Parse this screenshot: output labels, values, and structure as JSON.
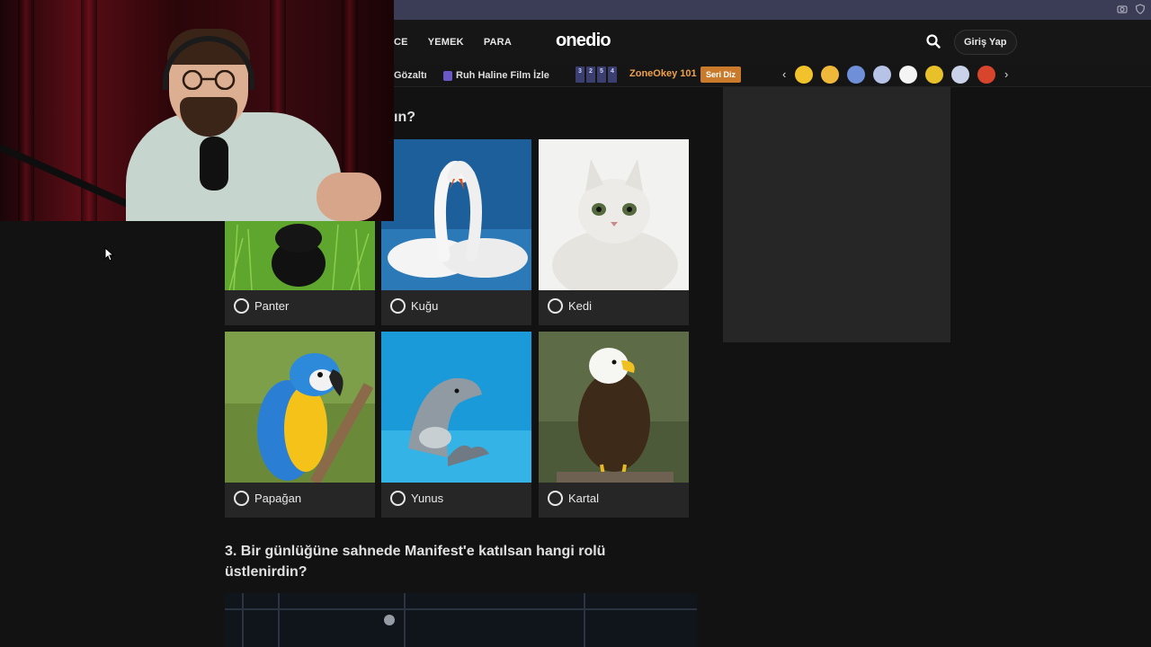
{
  "header": {
    "nav": [
      "CE",
      "YEMEK",
      "PARA"
    ],
    "logo": "onedio",
    "login_label": "Giriş Yap"
  },
  "subbar": {
    "item1": "Gözaltı",
    "item2": "Ruh Haline Film İzle",
    "seri_numbers": [
      "3",
      "2",
      "5",
      "4"
    ],
    "zone_label": "ZoneOkey 101",
    "seri_diz_label": "Seri Diz",
    "story_count": 8
  },
  "question2": {
    "title_partial": "ın?",
    "options": [
      {
        "label": "Panter",
        "icon": "panther-photo"
      },
      {
        "label": "Kuğu",
        "icon": "swan-photo"
      },
      {
        "label": "Kedi",
        "icon": "cat-photo"
      },
      {
        "label": "Papağan",
        "icon": "parrot-photo"
      },
      {
        "label": "Yunus",
        "icon": "dolphin-photo"
      },
      {
        "label": "Kartal",
        "icon": "eagle-photo"
      }
    ]
  },
  "question3": {
    "title": "3. Bir günlüğüne sahnede Manifest'e katılsan hangi rolü üstlenirdin?"
  },
  "colors": {
    "page_bg": "#121212",
    "card_bg": "#262626",
    "zone_orange": "#f0a24a",
    "seri_diz_bg": "#c97a2a",
    "browser_bar": "#3a3d55"
  }
}
